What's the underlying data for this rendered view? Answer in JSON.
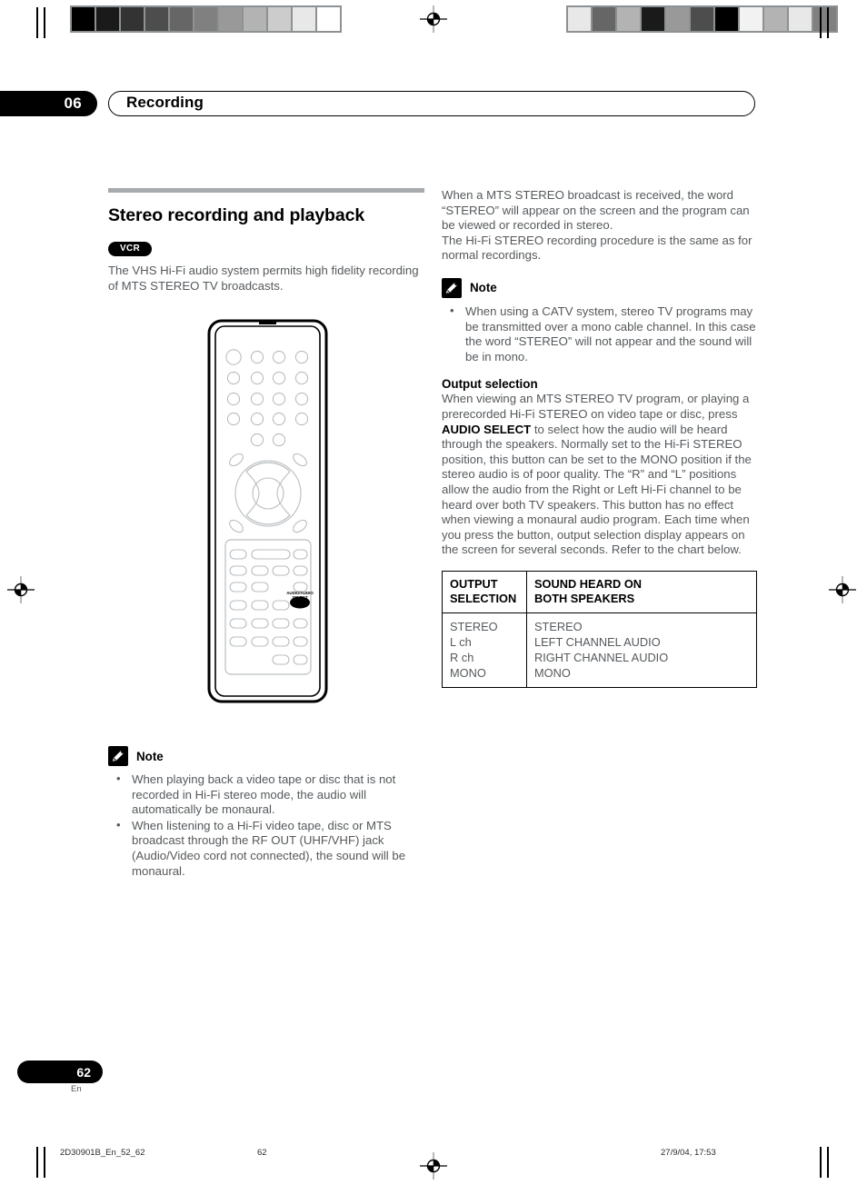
{
  "header": {
    "chapter_number": "06",
    "title": "Recording"
  },
  "left_column": {
    "section_title": "Stereo recording and playback",
    "tag": "VCR",
    "intro": "The VHS Hi-Fi audio system permits high fidelity recording of MTS STEREO TV broadcasts.",
    "note": {
      "label": "Note",
      "icon": "pencil-icon",
      "items": [
        "When playing back a video tape or disc that is not recorded in Hi-Fi stereo mode, the audio will automatically be monaural.",
        "When listening to a Hi-Fi video tape, disc or MTS broadcast through the RF OUT (UHF/VHF) jack (Audio/Video cord not connected), the sound will be monaural."
      ]
    },
    "remote": {
      "highlight_label": "AUDIO/AUDIO SELECT",
      "highlight_button_name": "audio-select-button"
    }
  },
  "right_column": {
    "paragraph_1": "When a MTS STEREO broadcast is received, the word “STEREO” will appear on the screen and the program can be viewed or recorded in stereo.",
    "paragraph_2": "The Hi-Fi STEREO recording procedure is the same as for normal recordings.",
    "note": {
      "label": "Note",
      "icon": "pencil-icon",
      "items": [
        "When using a CATV system, stereo TV programs may be transmitted over a mono cable channel. In this case the word “STEREO” will not appear and the sound will be in mono."
      ]
    },
    "output_selection": {
      "heading": "Output selection",
      "text_before_bold": "When viewing an MTS STEREO TV program, or playing a prerecorded Hi-Fi STEREO on video tape or disc, press ",
      "bold_term": "AUDIO SELECT",
      "text_after_bold": " to select how the audio will be heard through the speakers. Normally set to the Hi-Fi STEREO position, this button can be set to the MONO position if the stereo audio is of poor quality. The “R” and “L” positions allow the audio from the Right or Left Hi-Fi channel to be heard over both TV speakers. This button has no effect when viewing a monaural audio  program. Each time when you press the button, output selection display appears on the screen for several seconds. Refer to the chart below."
    },
    "table": {
      "headers": [
        "OUTPUT SELECTION",
        "SOUND HEARD ON BOTH SPEAKERS"
      ],
      "header_line1": [
        "OUTPUT",
        "SOUND HEARD ON"
      ],
      "header_line2": [
        "SELECTION",
        "BOTH SPEAKERS"
      ],
      "rows": [
        [
          "STEREO",
          "STEREO"
        ],
        [
          "L ch",
          "LEFT CHANNEL AUDIO"
        ],
        [
          "R ch",
          "RIGHT CHANNEL AUDIO"
        ],
        [
          "MONO",
          "MONO"
        ]
      ],
      "col1_cell": "STEREO\nL ch\nR ch\nMONO",
      "col2_cell": "STEREO\nLEFT CHANNEL AUDIO\nRIGHT CHANNEL AUDIO\nMONO"
    }
  },
  "footer": {
    "page_number": "62",
    "language": "En",
    "file_name": "2D30901B_En_52_62",
    "page_ref": "62",
    "date": "27/9/04, 17:53"
  },
  "registration": {
    "left_wedge": [
      "#000000",
      "#1a1a1a",
      "#333333",
      "#4d4d4d",
      "#666666",
      "#808080",
      "#999999",
      "#b3b3b3",
      "#cccccc",
      "#e8e8e8",
      "#ffffff"
    ],
    "right_wedge": [
      "#e8e8e8",
      "#666666",
      "#b3b3b3",
      "#1a1a1a",
      "#999999",
      "#4d4d4d",
      "#000000",
      "#f2f2f2",
      "#b3b3b3",
      "#e8e8e8",
      "#808080"
    ]
  },
  "colors": {
    "body_text": "#55595c",
    "heading": "#000000",
    "rule": "#a6aaad",
    "badge_bg": "#000000"
  }
}
